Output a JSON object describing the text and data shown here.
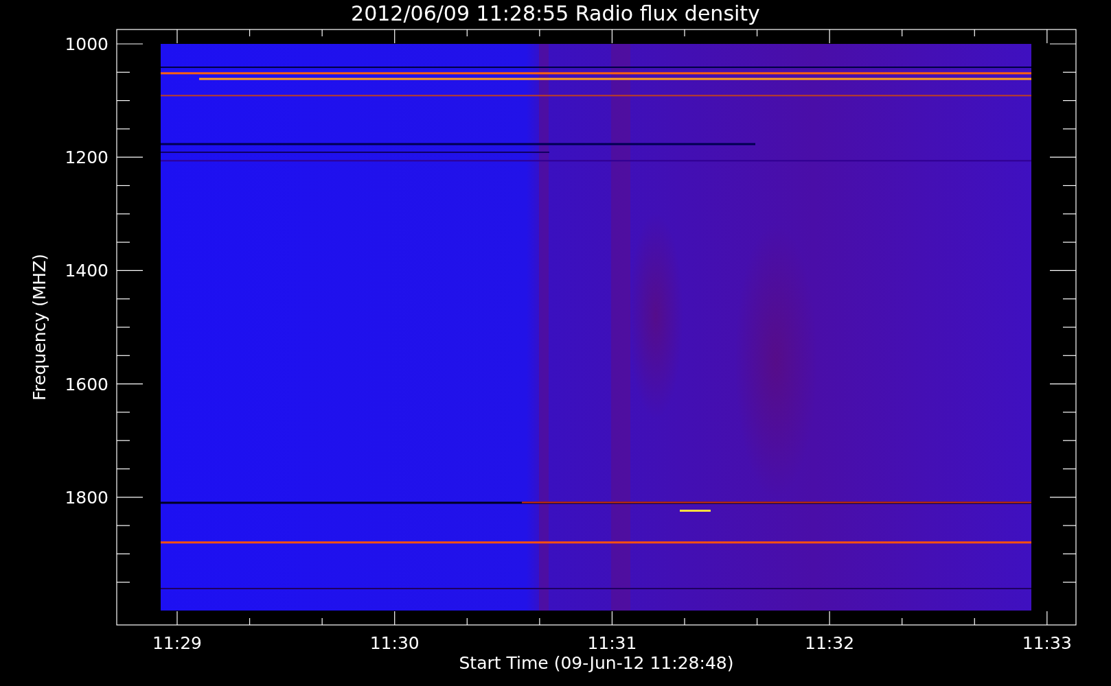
{
  "title": "2012/06/09 11:28:55 Radio flux density",
  "y_axis": {
    "label": "Frequency (MHZ)",
    "ticks": [
      "1000",
      "1200",
      "1400",
      "1600",
      "1800"
    ]
  },
  "x_axis": {
    "label": "Start Time (09-Jun-12 11:28:48)",
    "ticks": [
      "11:29",
      "11:30",
      "11:31",
      "11:32",
      "11:33"
    ]
  }
}
